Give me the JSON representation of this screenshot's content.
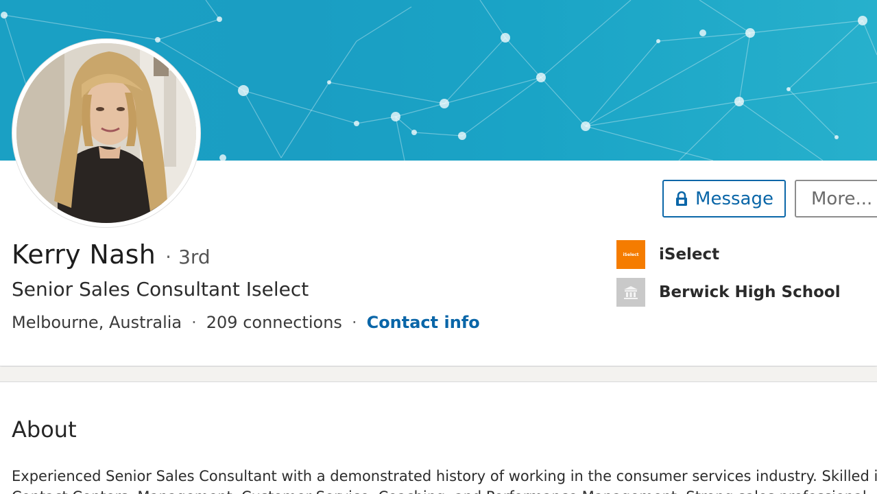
{
  "profile": {
    "name": "Kerry Nash",
    "degree_separator": "·",
    "degree": "3rd",
    "headline": "Senior Sales Consultant Iselect",
    "location": "Melbourne, Australia",
    "connections": "209 connections",
    "contact_info": "Contact info",
    "meta_separator": "·"
  },
  "actions": {
    "message_label": "Message",
    "more_label": "More...",
    "message_icon": "lock-icon"
  },
  "organizations": [
    {
      "name": "iSelect",
      "logo_text": "iSelect",
      "logo_color": "#f57c00"
    },
    {
      "name": "Berwick High School",
      "logo_icon": "school-building-icon",
      "logo_color": "#c9c9c9"
    }
  ],
  "about": {
    "title": "About",
    "text_line1": "Experienced Senior Sales Consultant with a demonstrated history of working in the consumer services industry. Skilled in",
    "text_line2": "Contact Centers, Management, Customer Service, Coaching, and Performance Management. Strong sales professional"
  },
  "colors": {
    "banner": "#1aa0c4",
    "link": "#0a66a8",
    "iselect_orange": "#f57c00"
  }
}
